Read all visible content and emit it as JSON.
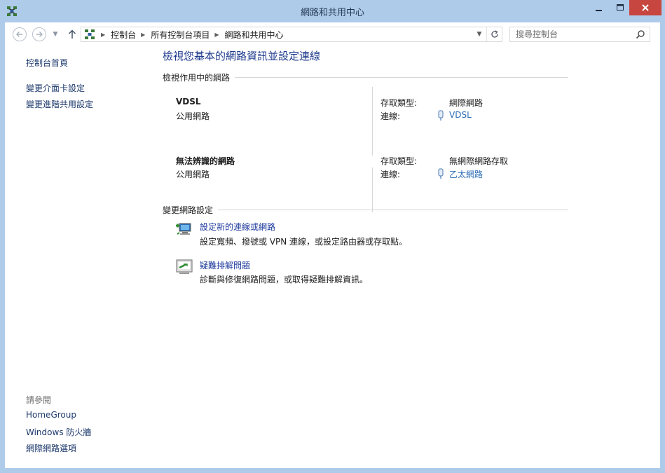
{
  "window": {
    "title": "網路和共用中心",
    "icon": "network-icon",
    "colors": {
      "frame": "#aecbea",
      "close": "#c7463f",
      "link": "#1e3a6c",
      "title": "#1e3b8c"
    }
  },
  "addressbar": {
    "crumbs": [
      "控制台",
      "所有控制台項目",
      "網路和共用中心"
    ],
    "search_placeholder": "搜尋控制台"
  },
  "sidebar": {
    "links": [
      "控制台首頁",
      "變更介面卡設定",
      "變更進階共用設定"
    ],
    "see_also_heading": "請參閱",
    "see_also": [
      "HomeGroup",
      "Windows 防火牆",
      "網際網路選項"
    ]
  },
  "main": {
    "title": "檢視您基本的網路資訊並設定連線",
    "active_section": "檢視作用中的網路",
    "networks": [
      {
        "name": "VDSL",
        "type": "公用網路",
        "access_label": "存取類型:",
        "access_value": "網際網路",
        "conn_label": "連線:",
        "conn_value": "VDSL",
        "conn_icon": "dialup-connection-icon"
      },
      {
        "name": "無法辨識的網路",
        "type": "公用網路",
        "access_label": "存取類型:",
        "access_value": "無網際網路存取",
        "conn_label": "連線:",
        "conn_value": "乙太網路",
        "conn_icon": "ethernet-connection-icon"
      }
    ],
    "change_section": "變更網路設定",
    "tasks": [
      {
        "link": "設定新的連線或網路",
        "desc": "設定寬頻、撥號或 VPN 連線，或設定路由器或存取點。",
        "icon": "new-connection-icon"
      },
      {
        "link": "疑難排解問題",
        "desc": "診斷與修復網路問題，或取得疑難排解資訊。",
        "icon": "troubleshoot-icon"
      }
    ]
  }
}
